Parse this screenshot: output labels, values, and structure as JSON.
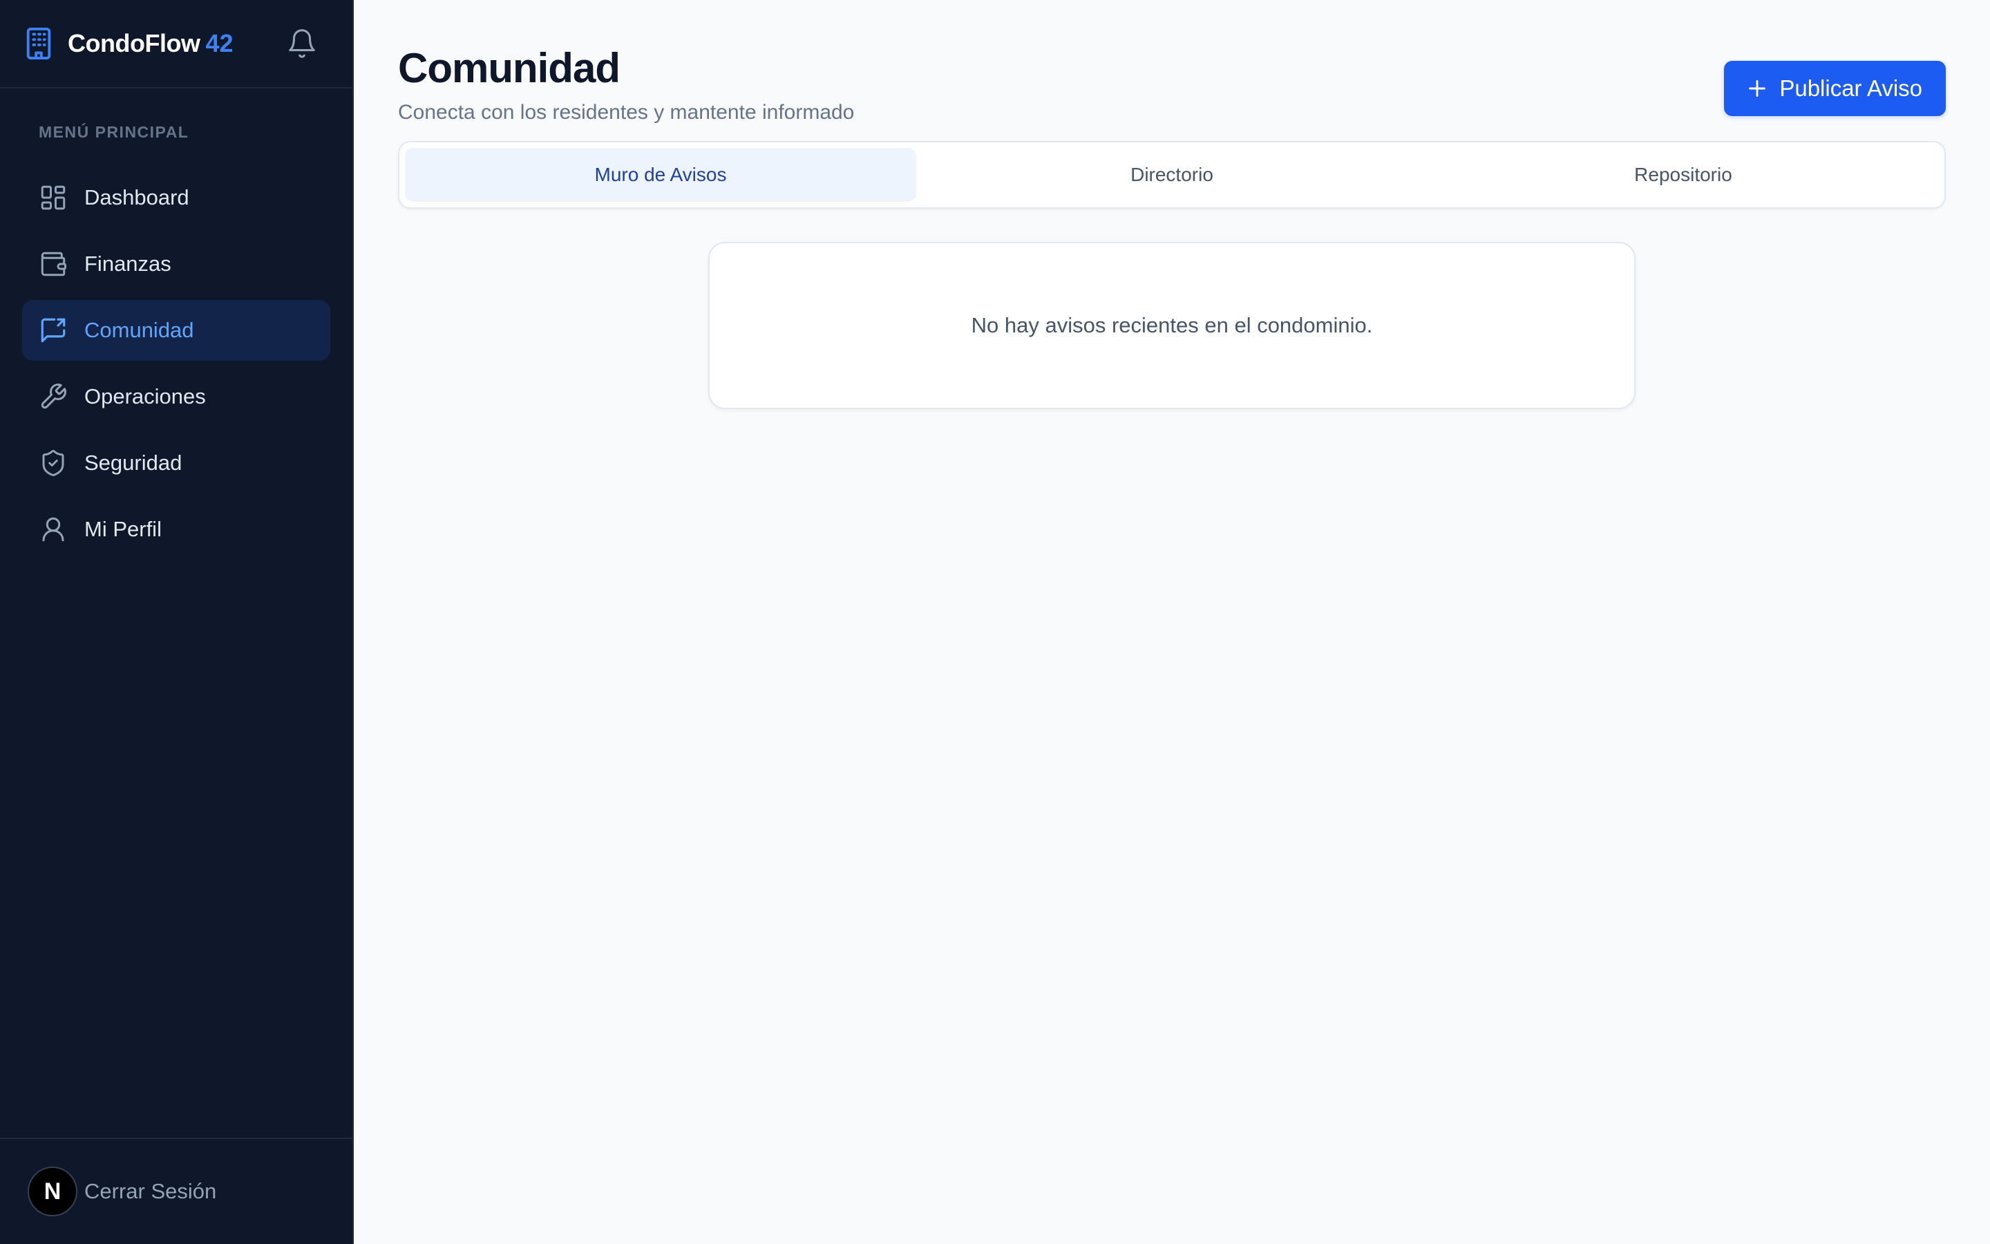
{
  "sidebar": {
    "brand": {
      "name": "CondoFlow",
      "number": "42",
      "icon": "building-icon"
    },
    "section_label": "MENÚ PRINCIPAL",
    "items": [
      {
        "label": "Dashboard",
        "icon": "dashboard-icon",
        "active": false
      },
      {
        "label": "Finanzas",
        "icon": "wallet-icon",
        "active": false
      },
      {
        "label": "Comunidad",
        "icon": "message-share-icon",
        "active": true
      },
      {
        "label": "Operaciones",
        "icon": "wrench-icon",
        "active": false
      },
      {
        "label": "Seguridad",
        "icon": "shield-check-icon",
        "active": false
      },
      {
        "label": "Mi Perfil",
        "icon": "user-icon",
        "active": false
      }
    ],
    "footer": {
      "avatar_letter": "N",
      "logout_label": "Cerrar Sesión"
    }
  },
  "header": {
    "title": "Comunidad",
    "subtitle": "Conecta con los residentes y mantente informado",
    "publish_label": "Publicar Aviso"
  },
  "tabs": [
    {
      "label": "Muro de Avisos",
      "active": true
    },
    {
      "label": "Directorio",
      "active": false
    },
    {
      "label": "Repositorio",
      "active": false
    }
  ],
  "feed": {
    "empty_message": "No hay avisos recientes en el condominio."
  },
  "colors": {
    "sidebar_bg": "#0f172a",
    "accent": "#1d5cf2",
    "active_nav": "#60a5fa"
  }
}
